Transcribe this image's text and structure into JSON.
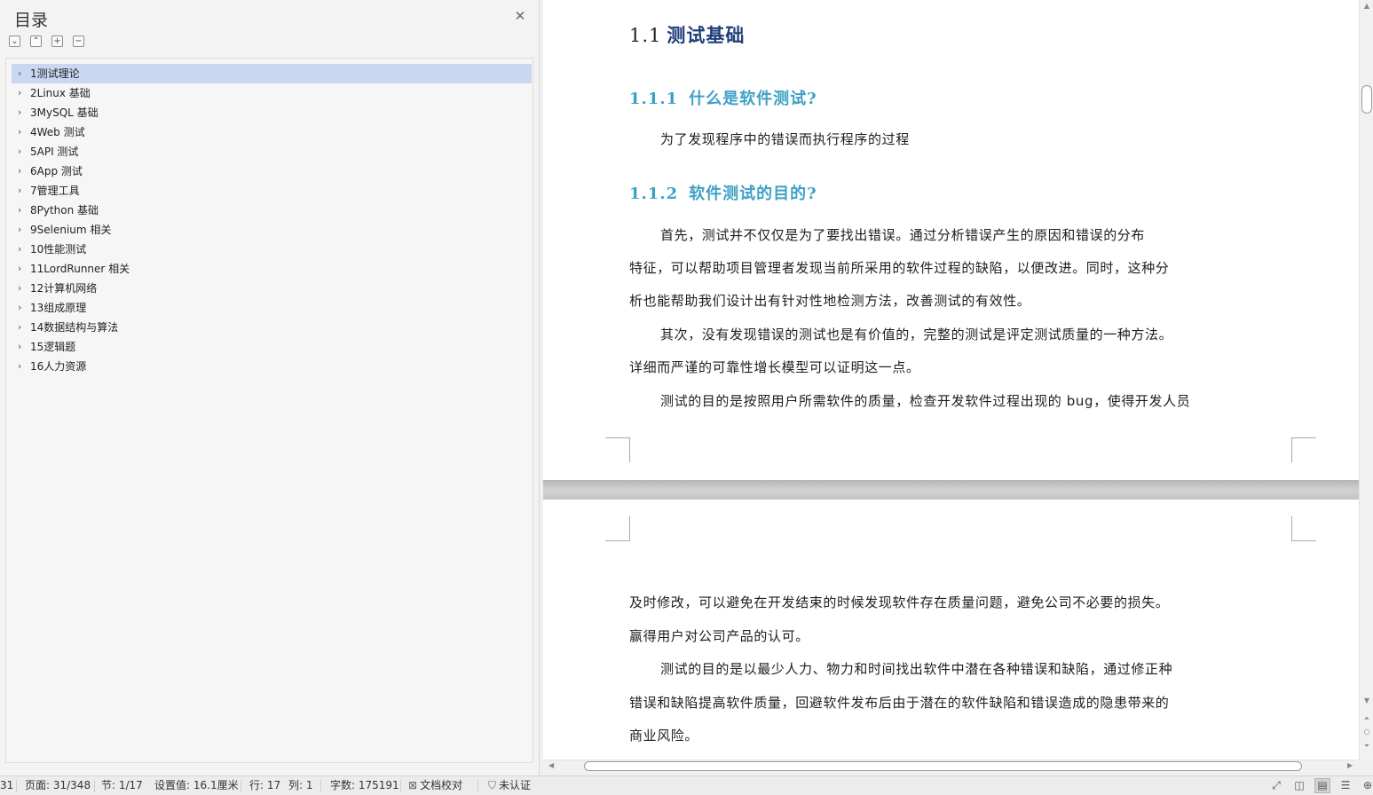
{
  "toc": {
    "title": "目录",
    "close_icon": "close-icon",
    "tools": [
      "expand-icon",
      "collapse-icon",
      "add-level-icon",
      "remove-level-icon"
    ],
    "items": [
      {
        "label": "1测试理论",
        "active": true
      },
      {
        "label": "2Linux 基础"
      },
      {
        "label": "3MySQL 基础"
      },
      {
        "label": "4Web 测试"
      },
      {
        "label": "5API 测试"
      },
      {
        "label": "6App 测试"
      },
      {
        "label": "7管理工具"
      },
      {
        "label": "8Python 基础"
      },
      {
        "label": "9Selenium 相关"
      },
      {
        "label": "10性能测试"
      },
      {
        "label": "11LordRunner 相关"
      },
      {
        "label": "12计算机网络"
      },
      {
        "label": "13组成原理"
      },
      {
        "label": "14数据结构与算法"
      },
      {
        "label": "15逻辑题"
      },
      {
        "label": "16人力资源"
      }
    ]
  },
  "document": {
    "h1": {
      "num": "1.1",
      "text": "测试基础"
    },
    "s1": {
      "num": "1.1.1",
      "text": "什么是软件测试?"
    },
    "s1_p": "为了发现程序中的错误而执行程序的过程",
    "s2": {
      "num": "1.1.2",
      "text": "软件测试的目的?"
    },
    "lines": [
      "首先，测试并不仅仅是为了要找出错误。通过分析错误产生的原因和错误的分布",
      "特征，可以帮助项目管理者发现当前所采用的软件过程的缺陷，以便改进。同时，这种分",
      "析也能帮助我们设计出有针对性地检测方法，改善测试的有效性。",
      "其次，没有发现错误的测试也是有价值的，完整的测试是评定测试质量的一种方法。",
      "详细而严谨的可靠性增长模型可以证明这一点。",
      "测试的目的是按照用户所需软件的质量，检查开发软件过程出现的 bug，使得开发人员"
    ],
    "page2_lines": [
      "及时修改，可以避免在开发结束的时候发现软件存在质量问题，避免公司不必要的损失。",
      "赢得用户对公司产品的认可。",
      "测试的目的是以最少人力、物力和时间找出软件中潜在各种错误和缺陷，通过修正种",
      "错误和缺陷提高软件质量，回避软件发布后由于潜在的软件缺陷和错误造成的隐患带来的",
      "商业风险。"
    ]
  },
  "status": {
    "left_num": "31",
    "page": "页面: 31/348",
    "section": "节: 1/17",
    "setting": "设置值: 16.1厘米",
    "row": "行: 17",
    "col": "列: 1",
    "words": "字数: 175191",
    "proof": "文档校对",
    "cert": "未认证"
  }
}
